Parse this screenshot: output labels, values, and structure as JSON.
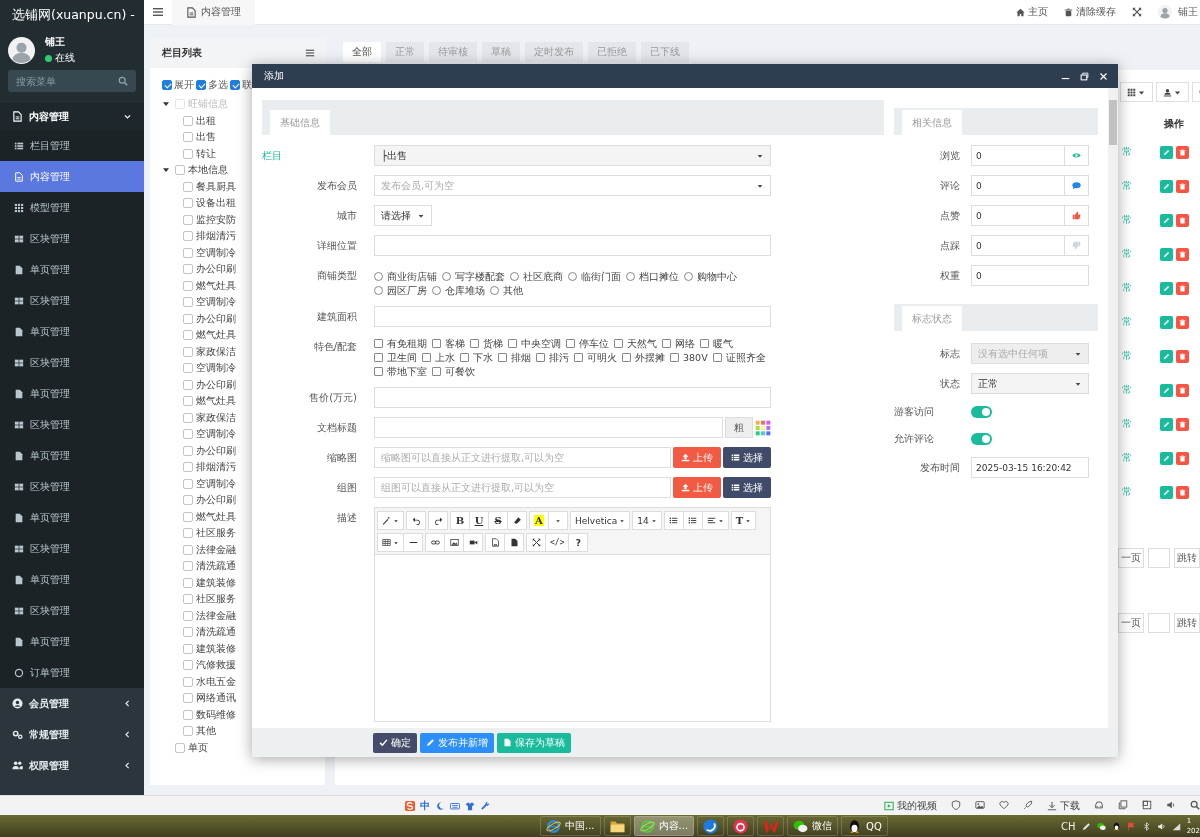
{
  "sidebar": {
    "title": "选铺网(xuanpu.cn) -",
    "user": {
      "name": "铺王",
      "status": "在线"
    },
    "search": {
      "placeholder": "搜索菜单"
    },
    "menu": [
      {
        "label": "内容管理",
        "kind": "content",
        "expanded": true,
        "children": [
          {
            "label": "栏目管理",
            "kind": "category",
            "selected": false
          },
          {
            "label": "内容管理",
            "kind": "content",
            "selected": true
          },
          {
            "label": "模型管理",
            "kind": "model",
            "selected": false
          },
          {
            "label": "区块管理",
            "kind": "block",
            "selected": false
          },
          {
            "label": "单页管理",
            "kind": "page",
            "selected": false
          },
          {
            "label": "区块管理",
            "kind": "block",
            "selected": false
          },
          {
            "label": "单页管理",
            "kind": "page",
            "selected": false
          },
          {
            "label": "区块管理",
            "kind": "block",
            "selected": false
          },
          {
            "label": "单页管理",
            "kind": "page",
            "selected": false
          },
          {
            "label": "区块管理",
            "kind": "block",
            "selected": false
          },
          {
            "label": "单页管理",
            "kind": "page",
            "selected": false
          },
          {
            "label": "区块管理",
            "kind": "block",
            "selected": false
          },
          {
            "label": "单页管理",
            "kind": "page",
            "selected": false
          },
          {
            "label": "区块管理",
            "kind": "block",
            "selected": false
          },
          {
            "label": "单页管理",
            "kind": "page",
            "selected": false
          },
          {
            "label": "区块管理",
            "kind": "block",
            "selected": false
          },
          {
            "label": "单页管理",
            "kind": "page",
            "selected": false
          },
          {
            "label": "订单管理",
            "kind": "order",
            "selected": false
          }
        ]
      },
      {
        "label": "会员管理",
        "kind": "member",
        "expanded": false
      },
      {
        "label": "常规管理",
        "kind": "settings",
        "expanded": false
      },
      {
        "label": "权限管理",
        "kind": "permission",
        "expanded": false
      }
    ]
  },
  "header": {
    "tab": "内容管理",
    "links": [
      {
        "label": "主页",
        "kind": "home"
      },
      {
        "label": "清除缓存",
        "kind": "clear"
      }
    ],
    "user": "铺王"
  },
  "column_panel": {
    "title": "栏目列表",
    "options": [
      {
        "label": "展开",
        "checked": true
      },
      {
        "label": "多选",
        "checked": true
      },
      {
        "label": "联",
        "checked": true
      }
    ],
    "tree": [
      {
        "label": "旺铺信息",
        "checked": false,
        "disabled": true,
        "expanded": true,
        "children": [
          {
            "label": "出租",
            "checked": false
          },
          {
            "label": "出售",
            "checked": false
          },
          {
            "label": "转让",
            "checked": false
          }
        ]
      },
      {
        "label": "本地信息",
        "checked": false,
        "disabled": false,
        "expanded": true,
        "children": [
          {
            "label": "餐具厨具",
            "checked": false
          },
          {
            "label": "设备出租",
            "checked": false
          },
          {
            "label": "监控安防",
            "checked": false
          },
          {
            "label": "排烟清污",
            "checked": false
          },
          {
            "label": "空调制冷",
            "checked": false
          },
          {
            "label": "办公印刷",
            "checked": false
          },
          {
            "label": "燃气灶具",
            "checked": false
          },
          {
            "label": "空调制冷",
            "checked": false
          },
          {
            "label": "办公印刷",
            "checked": false
          },
          {
            "label": "燃气灶具",
            "checked": false
          },
          {
            "label": "家政保洁",
            "checked": false
          },
          {
            "label": "空调制冷",
            "checked": false
          },
          {
            "label": "办公印刷",
            "checked": false
          },
          {
            "label": "燃气灶具",
            "checked": false
          },
          {
            "label": "家政保洁",
            "checked": false
          },
          {
            "label": "空调制冷",
            "checked": false
          },
          {
            "label": "办公印刷",
            "checked": false
          },
          {
            "label": "排烟清污",
            "checked": false
          },
          {
            "label": "空调制冷",
            "checked": false
          },
          {
            "label": "办公印刷",
            "checked": false
          },
          {
            "label": "燃气灶具",
            "checked": false
          },
          {
            "label": "社区服务",
            "checked": false
          },
          {
            "label": "法律金融",
            "checked": false
          },
          {
            "label": "清洗疏通",
            "checked": false
          },
          {
            "label": "建筑装修",
            "checked": false
          },
          {
            "label": "社区服务",
            "checked": false
          },
          {
            "label": "法律金融",
            "checked": false
          },
          {
            "label": "清洗疏通",
            "checked": false
          },
          {
            "label": "建筑装修",
            "checked": false
          },
          {
            "label": "汽修救援",
            "checked": false
          },
          {
            "label": "水电五金",
            "checked": false
          },
          {
            "label": "网络通讯",
            "checked": false
          },
          {
            "label": "数码维修",
            "checked": false
          },
          {
            "label": "其他",
            "checked": false
          }
        ]
      },
      {
        "label": "单页",
        "checked": false,
        "disabled": false
      }
    ]
  },
  "content": {
    "tabs": [
      {
        "label": "全部",
        "selected": true
      },
      {
        "label": "正常",
        "selected": false
      },
      {
        "label": "待审核",
        "selected": false
      },
      {
        "label": "草稿",
        "selected": false
      },
      {
        "label": "定时发布",
        "selected": false
      },
      {
        "label": "已拒绝",
        "selected": false
      },
      {
        "label": "已下线",
        "selected": false
      }
    ],
    "table": {
      "columns": [
        "操作"
      ],
      "rows": [
        {
          "status": "常"
        },
        {
          "status": "常"
        },
        {
          "status": "常"
        },
        {
          "status": "常"
        },
        {
          "status": "常"
        },
        {
          "status": "常"
        },
        {
          "status": "常"
        },
        {
          "status": "常"
        },
        {
          "status": "常"
        },
        {
          "status": "常"
        },
        {
          "status": "常"
        }
      ]
    },
    "pagination": [
      {
        "prev": "一页",
        "go": "跳转"
      },
      {
        "prev": "一页",
        "go": "跳转"
      }
    ]
  },
  "dialog": {
    "title": "添加",
    "basic": {
      "tab": "基础信息",
      "fields": [
        {
          "kind": "select",
          "label": "栏目",
          "value": "├出售",
          "highlighted": true
        },
        {
          "kind": "select",
          "label": "发布会员",
          "placeholder": "发布会员,可为空",
          "highlighted": false
        },
        {
          "kind": "mini-select",
          "label": "城市",
          "value": "请选择",
          "highlighted": false
        },
        {
          "kind": "text",
          "label": "详细位置",
          "highlighted": false
        },
        {
          "kind": "radios",
          "label": "商铺类型",
          "highlighted": false,
          "options": [
            {
              "label": "商业街店铺",
              "selected": false
            },
            {
              "label": "写字楼配套",
              "selected": false
            },
            {
              "label": "社区底商",
              "selected": false
            },
            {
              "label": "临街门面",
              "selected": false
            },
            {
              "label": "档口摊位",
              "selected": false
            },
            {
              "label": "购物中心",
              "selected": false
            },
            {
              "label": "园区厂房",
              "selected": false
            },
            {
              "label": "仓库堆场",
              "selected": false
            },
            {
              "label": "其他",
              "selected": false
            }
          ]
        },
        {
          "kind": "text",
          "label": "建筑面积",
          "highlighted": false
        },
        {
          "kind": "checks",
          "label": "特色/配套",
          "highlighted": false,
          "options": [
            {
              "label": "有免租期",
              "checked": false
            },
            {
              "label": "客梯",
              "checked": false
            },
            {
              "label": "货梯",
              "checked": false
            },
            {
              "label": "中央空调",
              "checked": false
            },
            {
              "label": "停车位",
              "checked": false
            },
            {
              "label": "天然气",
              "checked": false
            },
            {
              "label": "网络",
              "checked": false
            },
            {
              "label": "暖气",
              "checked": false
            },
            {
              "label": "卫生间",
              "checked": false
            },
            {
              "label": "上水",
              "checked": false
            },
            {
              "label": "下水",
              "checked": false
            },
            {
              "label": "排烟",
              "checked": false
            },
            {
              "label": "排污",
              "checked": false
            },
            {
              "label": "可明火",
              "checked": false
            },
            {
              "label": "外摆摊",
              "checked": false
            },
            {
              "label": "380V",
              "checked": false
            },
            {
              "label": "证照齐全",
              "checked": false
            },
            {
              "label": "带地下室",
              "checked": false
            },
            {
              "label": "可餐饮",
              "checked": false
            }
          ]
        },
        {
          "kind": "text",
          "label": "售价(万元)",
          "highlighted": false
        },
        {
          "kind": "title",
          "label": "文档标题",
          "highlighted": false,
          "bold": "粗"
        },
        {
          "kind": "upload",
          "label": "缩略图",
          "highlighted": false,
          "placeholder": "缩略图可以直接从正文进行提取,可以为空",
          "upload": "上传",
          "choose": "选择"
        },
        {
          "kind": "upload",
          "label": "组图",
          "highlighted": false,
          "placeholder": "组图可以直接从正文进行提取,可以为空",
          "upload": "上传",
          "choose": "选择"
        },
        {
          "kind": "editor",
          "label": "描述",
          "highlighted": false,
          "toolbar": [
            [
              [
                {
                  "kind": "wand",
                  "dropdown": true
                }
              ],
              [
                {
                  "kind": "undo"
                }
              ],
              [
                {
                  "kind": "redo"
                }
              ],
              [
                {
                  "kind": "bold",
                  "label": "B"
                },
                {
                  "kind": "underline",
                  "label": "U"
                },
                {
                  "kind": "strikethrough",
                  "label": "S"
                },
                {
                  "kind": "eraser"
                }
              ],
              [
                {
                  "kind": "text-color",
                  "label": "A"
                },
                {
                  "kind": "color-dropdown",
                  "dropdown": true
                }
              ],
              [
                {
                  "kind": "font",
                  "label": "Helvetica",
                  "dropdown": true
                }
              ],
              [
                {
                  "kind": "font-size",
                  "label": "14",
                  "dropdown": true
                }
              ],
              [
                {
                  "kind": "bullet-list"
                },
                {
                  "kind": "numbered-list"
                },
                {
                  "kind": "align",
                  "dropdown": true
                }
              ],
              [
                {
                  "kind": "line-height",
                  "label": "T",
                  "dropdown": true
                }
              ]
            ],
            [
              [
                {
                  "kind": "table",
                  "dropdown": true
                },
                {
                  "kind": "horizontal-rule"
                }
              ],
              [
                {
                  "kind": "link"
                },
                {
                  "kind": "picture"
                },
                {
                  "kind": "video"
                }
              ],
              [
                {
                  "kind": "image-file"
                },
                {
                  "kind": "file"
                }
              ],
              [
                {
                  "kind": "fullscreen"
                },
                {
                  "kind": "code",
                  "label": "</>"
                },
                {
                  "kind": "help",
                  "label": "?"
                }
              ]
            ]
          ]
        }
      ]
    },
    "related": {
      "tab": "相关信息",
      "fields": [
        {
          "kind": "views",
          "label": "浏览",
          "value": "0"
        },
        {
          "kind": "comments",
          "label": "评论",
          "value": "0"
        },
        {
          "kind": "likes",
          "label": "点赞",
          "value": "0"
        },
        {
          "kind": "dislikes",
          "label": "点踩",
          "value": "0"
        },
        {
          "kind": "weight",
          "label": "权重",
          "value": "0"
        }
      ]
    },
    "flags": {
      "tab": "标志状态",
      "fields": [
        {
          "kind": "select",
          "label": "标志",
          "placeholder": "没有选中任何项",
          "disabled": true
        },
        {
          "kind": "select",
          "label": "状态",
          "value": "正常",
          "disabled": false
        },
        {
          "kind": "switch",
          "label": "游客访问",
          "on": true
        },
        {
          "kind": "switch",
          "label": "允许评论",
          "on": true
        },
        {
          "kind": "text",
          "label": "发布时间",
          "value": "2025-03-15 16:20:42"
        }
      ]
    },
    "buttons": [
      {
        "kind": "confirm",
        "label": "确定"
      },
      {
        "kind": "publish",
        "label": "发布并新增"
      },
      {
        "kind": "draft",
        "label": "保存为草稿"
      }
    ]
  },
  "status_bar": {
    "ime": "中",
    "links": [
      {
        "kind": "video",
        "label": "我的视频"
      },
      {
        "kind": "download",
        "label": "下载"
      }
    ]
  },
  "taskbar": {
    "items": [
      {
        "kind": "ie",
        "label": "中国...",
        "selected": false
      },
      {
        "kind": "folder",
        "selected": false
      },
      {
        "kind": "green-browser",
        "label": "内容...",
        "selected": true
      },
      {
        "kind": "round-app",
        "selected": false
      },
      {
        "kind": "ring-app",
        "selected": false
      },
      {
        "kind": "office",
        "selected": false
      },
      {
        "kind": "wechat",
        "label": "微信",
        "selected": false
      },
      {
        "kind": "qq",
        "label": "QQ",
        "selected": false
      }
    ],
    "tray": {
      "lang": "CH",
      "time": "1",
      "date": "202"
    }
  }
}
